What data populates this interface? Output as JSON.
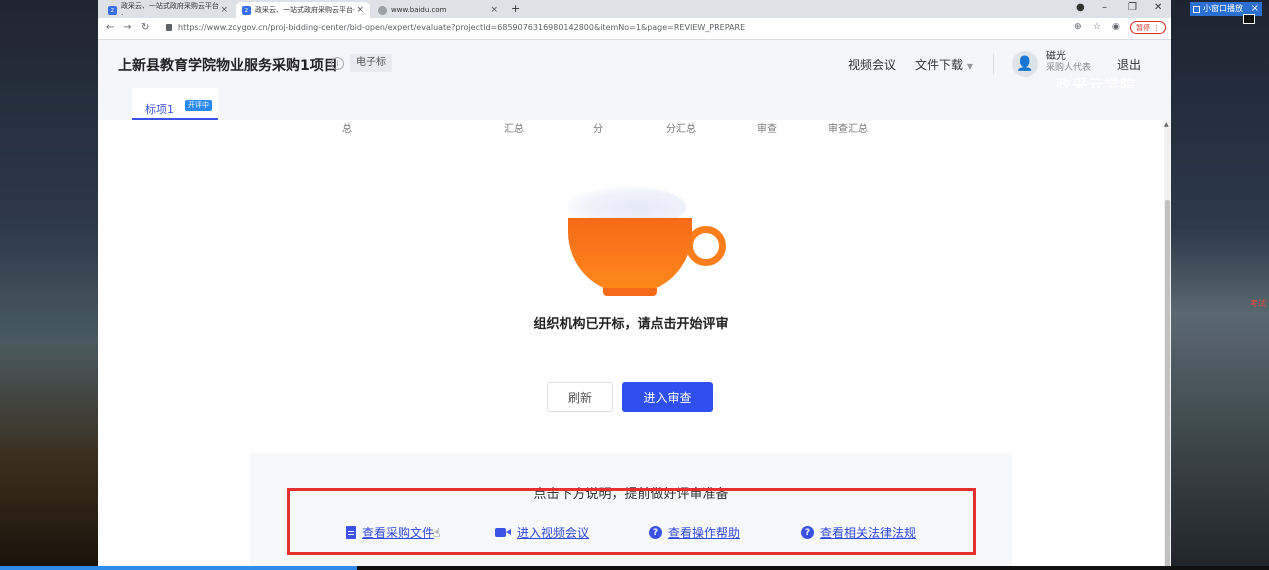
{
  "desktop": {
    "mini_player_label": "小窗口播放",
    "red_text": "考试"
  },
  "browser": {
    "tabs": [
      {
        "title": "政采云、一站式政府采购云平台·",
        "active": false,
        "favicon": "zcy-icon"
      },
      {
        "title": "政采云、一站式政府采购云平台·",
        "active": true,
        "favicon": "zcy-icon"
      },
      {
        "title": "www.baidu.com",
        "active": false,
        "favicon": "globe-icon"
      }
    ],
    "new_tab": "+",
    "url": "https://www.zcygov.cn/proj-bidding-center/bid-open/expert/evaluate?projectId=6859076316980142800&itemNo=1&page=REVIEW_PREPARE",
    "pause_label": "暂停"
  },
  "header": {
    "project_title": "上新县教育学院物业服务采购1项目",
    "bid_type": "电子标",
    "video_meeting": "视频会议",
    "file_download": "文件下载",
    "user_name": "磁光",
    "user_role": "采购人代表",
    "logout": "退出",
    "watermark": "政采云学院"
  },
  "section": {
    "tab_label": "标项1",
    "badge": "开评中"
  },
  "table_header_ghost": [
    "总",
    "汇总",
    "分",
    "分汇总",
    "审查",
    "审查汇总"
  ],
  "main": {
    "status_message": "组织机构已开标，请点击开始评审",
    "refresh_button": "刷新",
    "enter_review_button": "进入审查"
  },
  "guide": {
    "intro": "点击下方说明，提前做好评审准备",
    "links": [
      {
        "label": "查看采购文件",
        "icon": "document-icon"
      },
      {
        "label": "进入视频会议",
        "icon": "video-icon"
      },
      {
        "label": "查看操作帮助",
        "icon": "help-icon"
      },
      {
        "label": "查看相关法律法规",
        "icon": "help-icon"
      }
    ]
  },
  "colors": {
    "accent": "#2f4ff0",
    "highlight_box": "#e63030",
    "cup_orange": "#f56a18",
    "badge_blue": "#2b8af0"
  }
}
